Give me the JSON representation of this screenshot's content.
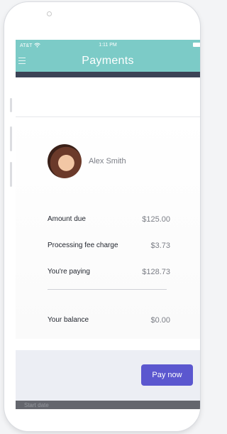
{
  "status_bar": {
    "carrier": "AT&T",
    "time": "1:11 PM"
  },
  "header": {
    "title": "Payments"
  },
  "user": {
    "name": "Alex Smith"
  },
  "summary": {
    "rows": [
      {
        "label": "Amount due",
        "value": "$125.00"
      },
      {
        "label": "Processing fee charge",
        "value": "$3.73"
      },
      {
        "label": "You're paying",
        "value": "$128.73"
      }
    ],
    "balance": {
      "label": "Your balance",
      "value": "$0.00"
    }
  },
  "footer": {
    "pay_label": "Pay now"
  },
  "bottom_bar": {
    "hint": "Start date"
  },
  "colors": {
    "header": "#7ccbc7",
    "accent": "#5b57cf",
    "dark_bar": "#3c4356"
  }
}
